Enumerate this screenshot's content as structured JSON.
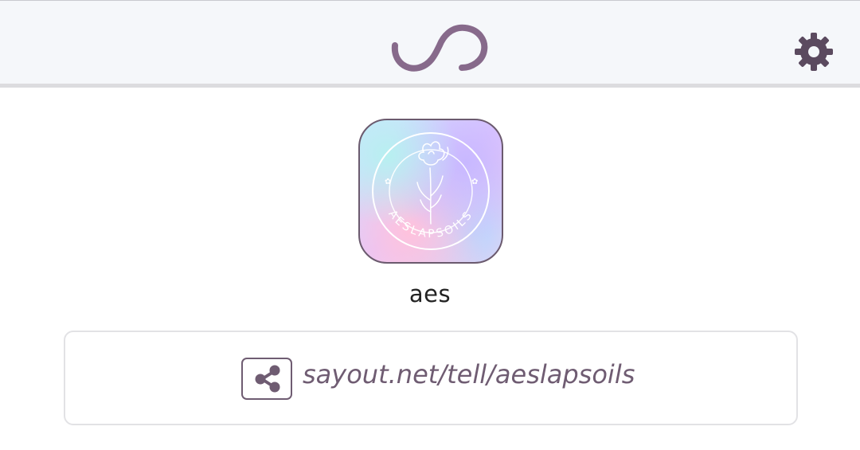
{
  "header": {
    "logo_icon": "infinity-loop-icon",
    "settings_icon": "gear-icon"
  },
  "profile": {
    "avatar_text": "AESLAPSOILS",
    "username": "aes"
  },
  "share": {
    "icon": "share-icon",
    "link_text": "sayout.net/tell/aeslapsoils"
  },
  "colors": {
    "brand": "#7b5a7e",
    "header_bg": "#f5f7fa"
  }
}
